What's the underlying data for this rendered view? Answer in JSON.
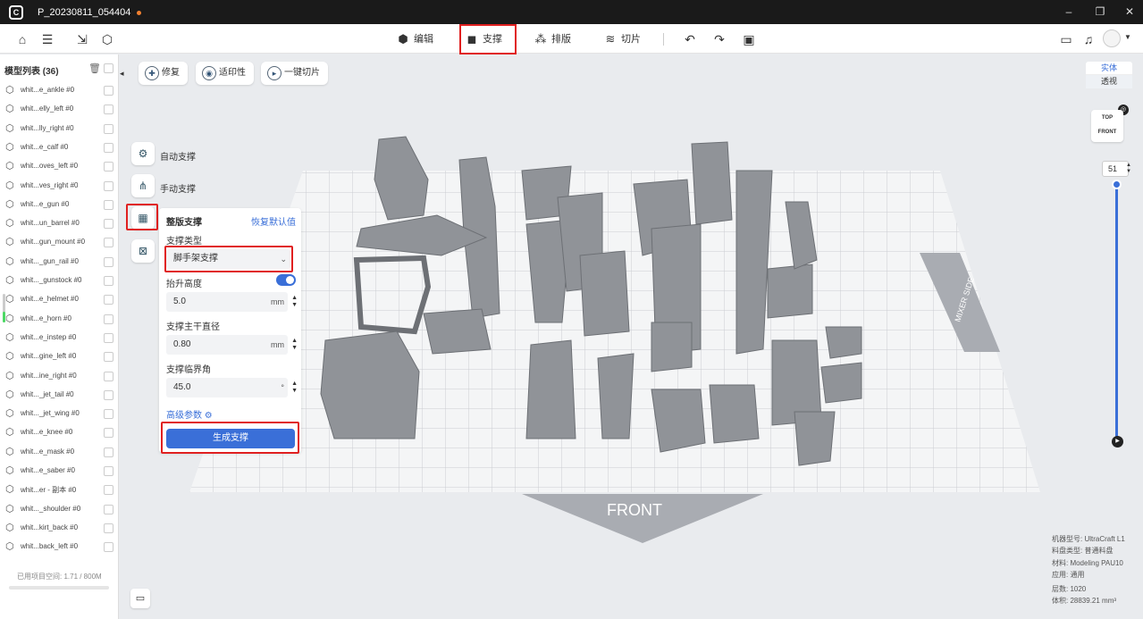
{
  "app": {
    "file_name": "P_20230811_054404",
    "logo": "C"
  },
  "window_controls": {
    "minimize": "–",
    "restore": "❐",
    "close": "✕"
  },
  "tabs": [
    {
      "label": "编辑",
      "icon": "edit-icon"
    },
    {
      "label": "支撑",
      "icon": "support-icon",
      "active": true
    },
    {
      "label": "排版",
      "icon": "layout-icon"
    },
    {
      "label": "切片",
      "icon": "slice-icon"
    }
  ],
  "sidebar": {
    "title": "模型列表 (36)",
    "items": [
      "whit...e_ankle #0",
      "whit...elly_left #0",
      "whit...lly_right #0",
      "whit...e_calf #0",
      "whit...oves_left #0",
      "whit...ves_right #0",
      "whit...e_gun #0",
      "whit...un_barrel #0",
      "whit...gun_mount #0",
      "whit..._gun_rail #0",
      "whit..._gunstock #0",
      "whit...e_helmet #0",
      "whit...e_horn #0",
      "whit...e_instep #0",
      "whit...gine_left #0",
      "whit...ine_right #0",
      "whit..._jet_tail #0",
      "whit..._jet_wing #0",
      "whit...e_knee #0",
      "whit...e_mask #0",
      "whit...e_saber #0",
      "whit...er - 副本 #0",
      "whit..._shoulder #0",
      "whit...kirt_back #0",
      "whit...back_left #0"
    ],
    "footer": "已用项目空间: 1.71 / 800M"
  },
  "top_actions": [
    {
      "label": "修复",
      "icon": "repair-icon"
    },
    {
      "label": "适印性",
      "icon": "printability-icon"
    },
    {
      "label": "一键切片",
      "icon": "one-click-slice-icon"
    }
  ],
  "side_tools": {
    "auto": "自动支撑",
    "manual": "手动支撑"
  },
  "panel": {
    "title": "整版支撑",
    "reset": "恢复默认值",
    "type_label": "支撑类型",
    "type_value": "脚手架支撑",
    "lift_label": "抬升高度",
    "lift_value": "5.0",
    "lift_unit": "mm",
    "trunk_label": "支撑主干直径",
    "trunk_value": "0.80",
    "trunk_unit": "mm",
    "angle_label": "支撑临界角",
    "angle_value": "45.0",
    "angle_unit": "°",
    "advanced": "高级参数",
    "generate": "生成支撑"
  },
  "view": {
    "solid": "实体",
    "perspective": "透视",
    "cube_top": "TOP",
    "cube_front": "FRONT"
  },
  "scene": {
    "front_label": "FRONT",
    "side_label": "MIXER SIDE"
  },
  "layer": {
    "value": "51"
  },
  "info": {
    "machine": "机器型号: UltraCraft L1",
    "tray": "料盘类型: 普通料盘",
    "material": "材料: Modeling PAU10",
    "app": "应用: 通用",
    "layers": "层数: 1020",
    "volume": "体积: 28839.21 mm³"
  },
  "colors": {
    "accent": "#3a6fd8",
    "highlight": "#e02020",
    "active_toggle": "#3a6fd8"
  }
}
